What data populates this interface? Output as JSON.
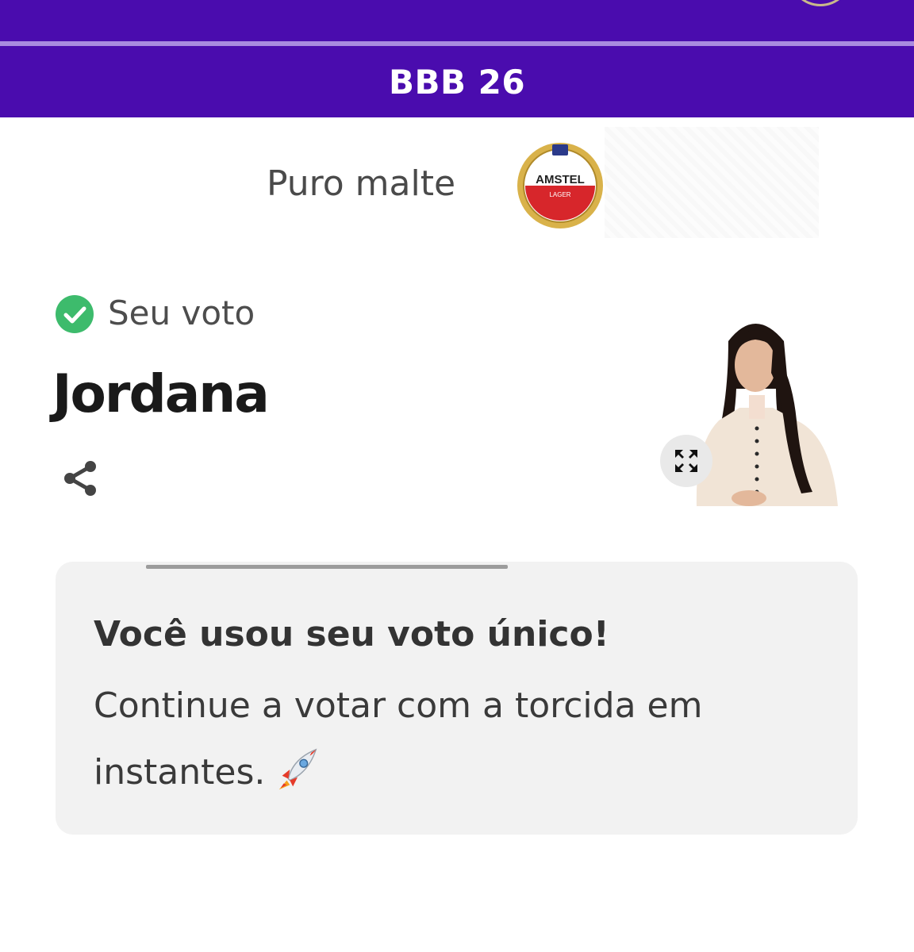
{
  "header": {
    "section_title": "BBB 26"
  },
  "sponsor": {
    "tagline": "Puro malte",
    "logo_text": "AMSTEL",
    "logo_subtext": "LAGER"
  },
  "vote": {
    "label": "Seu voto",
    "candidate": "Jordana",
    "status_color": "#3dbb6c"
  },
  "message": {
    "title": "Você usou seu voto único!",
    "body": "Continue a votar com a torcida em instantes."
  },
  "icons": {
    "status": "check-circle-icon",
    "share": "share-icon",
    "expand": "expand-icon",
    "emoji": "rocket-icon"
  },
  "colors": {
    "brand": "#4a0cae",
    "brand_divider": "#a98be0",
    "card_bg": "#f2f2f2"
  }
}
